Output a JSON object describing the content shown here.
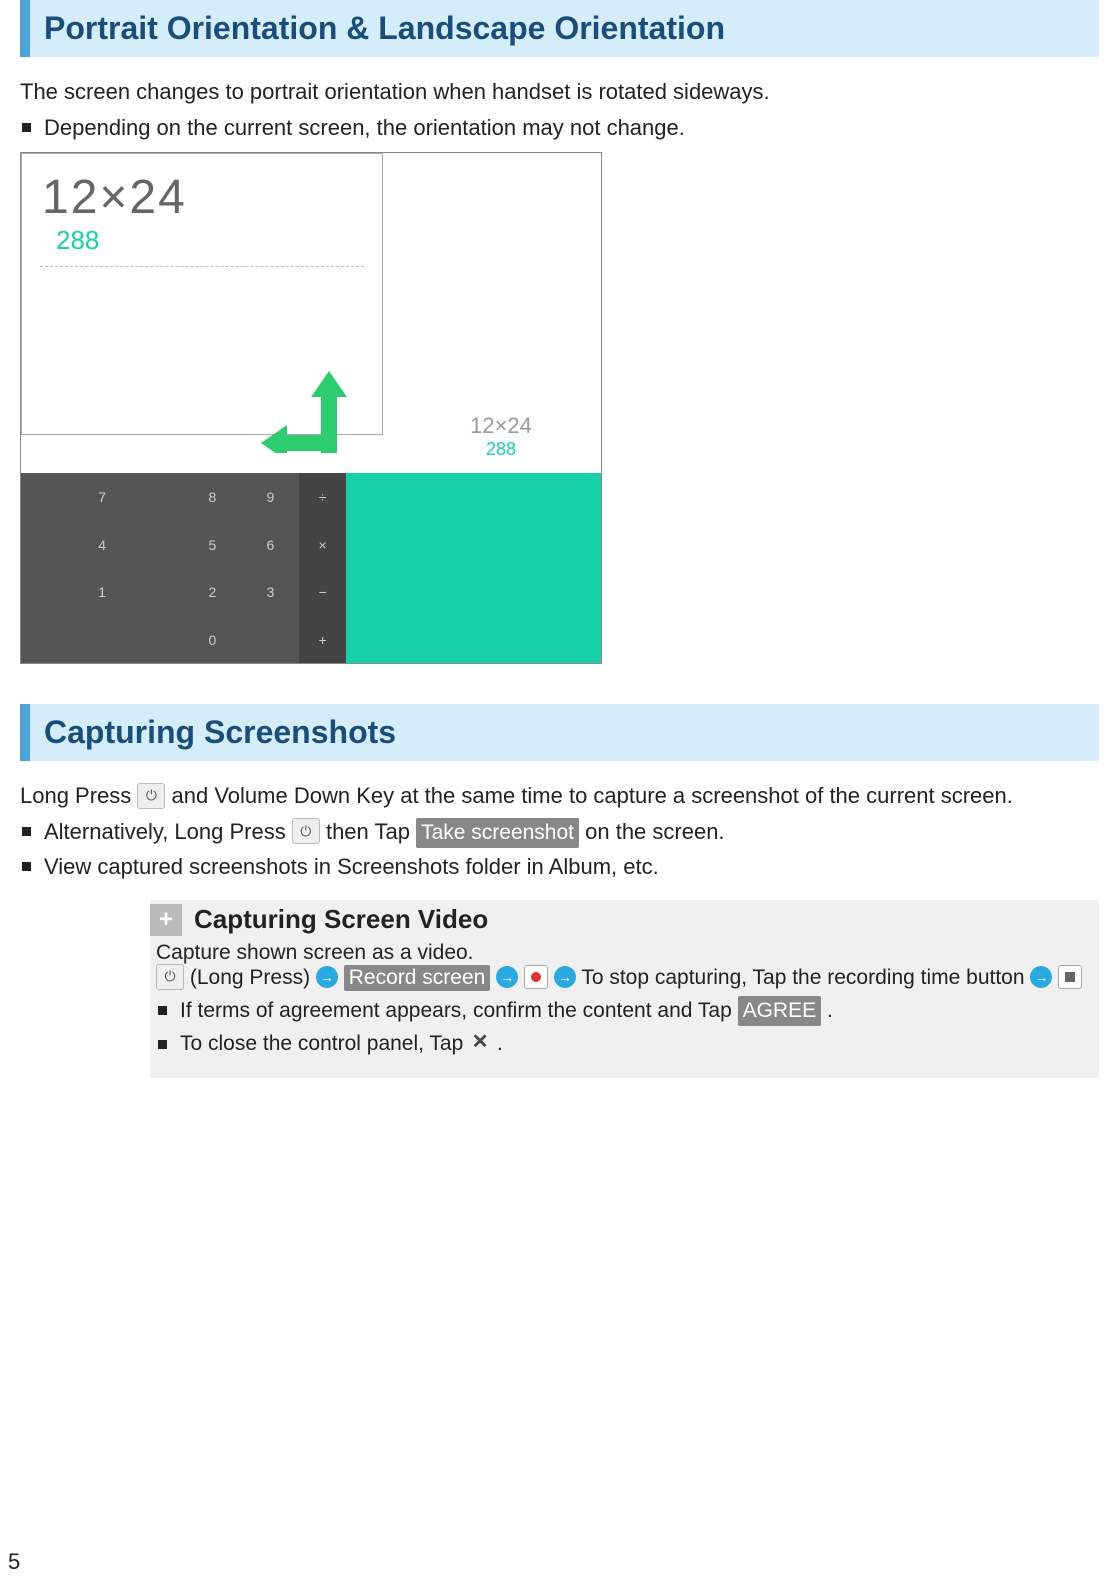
{
  "section1": {
    "title": "Portrait Orientation & Landscape Orientation",
    "intro": "The screen changes to portrait orientation when handset is rotated sideways.",
    "bullet1": "Depending on the current screen, the orientation may not change.",
    "illus": {
      "expr": "12×24",
      "result": "288",
      "expr2": "12×24",
      "result2": "288"
    }
  },
  "section2": {
    "title": "Capturing Screenshots",
    "line1a": "Long Press ",
    "line1b": " and Volume Down Key at the same time to capture a screenshot of the current screen.",
    "bullet1a": "Alternatively, Long Press ",
    "bullet1b": " then Tap ",
    "bullet1_pill": "Take screenshot",
    "bullet1c": " on the screen.",
    "bullet2": "View captured screenshots in Screenshots folder in Album, etc."
  },
  "tip": {
    "title": "Capturing Screen Video",
    "intro": "Capture shown screen as a video.",
    "seq1": " (Long Press)",
    "seq_pill": "Record screen",
    "seq2": " To stop capturing, Tap the recording time button",
    "bullet1a": "If terms of agreement appears, confirm the content and Tap ",
    "bullet1_pill": "AGREE",
    "bullet1b": ".",
    "bullet2a": "To close the control panel, Tap ",
    "bullet2b": "."
  },
  "page": "5"
}
